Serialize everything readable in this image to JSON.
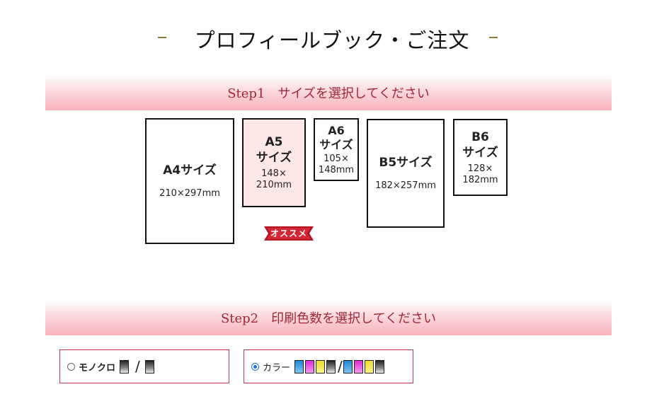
{
  "page": {
    "title": "プロフィールブック・ご注文"
  },
  "step1": {
    "label": "Step1　サイズを選択してください",
    "sizes": [
      {
        "name": "A4サイズ",
        "dims": "210×297mm",
        "selected": false
      },
      {
        "name_line1": "A5",
        "name_line2": "サイズ",
        "dims_line1": "148×",
        "dims_line2": "210mm",
        "selected": true
      },
      {
        "name_line1": "A6",
        "name_line2": "サイズ",
        "dims_line1": "105×",
        "dims_line2": "148mm",
        "selected": false
      },
      {
        "name": "B5サイズ",
        "dims": "182×257mm",
        "selected": false
      },
      {
        "name_line1": "B6",
        "name_line2": "サイズ",
        "dims_line1": "128×",
        "dims_line2": "182mm",
        "selected": false
      }
    ],
    "recommend_badge": "オススメ"
  },
  "step2": {
    "label": "Step2　印刷色数を選択してください",
    "options": [
      {
        "label": "モノクロ",
        "selected": false,
        "separator": "/",
        "inks_front": [
          "black"
        ],
        "inks_back": [
          "black"
        ]
      },
      {
        "label": "カラー",
        "selected": true,
        "separator": "/",
        "inks_front": [
          "cyan",
          "magenta",
          "yellow",
          "black"
        ],
        "inks_back": [
          "cyan",
          "magenta",
          "yellow",
          "black"
        ]
      }
    ]
  },
  "colors": {
    "step_text": "#a0283a",
    "step_bar": "#f7b2bb",
    "option_border": "#c7354a",
    "selected_card_bg": "#fde6e6",
    "radio_checked": "#1a73e8",
    "badge": "#b3121f"
  }
}
